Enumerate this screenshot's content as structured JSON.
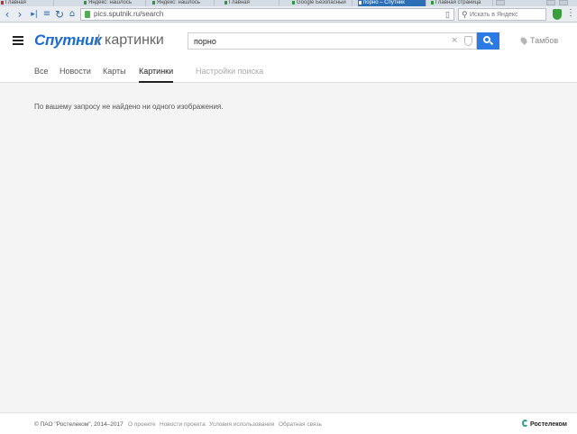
{
  "browser": {
    "tabs": [
      {
        "label": "Главная",
        "active": false
      },
      {
        "label": "Яндекс: нашлось",
        "active": false
      },
      {
        "label": "Яндекс: нашлось",
        "active": false
      },
      {
        "label": "Главная",
        "active": false
      },
      {
        "label": "Google Безопасный",
        "active": false
      },
      {
        "label": "порно – Спутник",
        "active": true
      },
      {
        "label": "Главная страница",
        "active": false
      }
    ],
    "url": "pics.sputnik.ru/search",
    "ya_search_placeholder": "Искать в Яндекс"
  },
  "header": {
    "logo": "Спутник",
    "separator": "/",
    "subtitle": "картинки",
    "search_value": "порно",
    "city": "Тамбов"
  },
  "tabs": [
    {
      "label": "Все",
      "active": false
    },
    {
      "label": "Новости",
      "active": false
    },
    {
      "label": "Карты",
      "active": false
    },
    {
      "label": "Картинки",
      "active": true
    },
    {
      "label": "Настройки поиска",
      "active": false
    }
  ],
  "main": {
    "message": "По вашему запросу не найдено ни одного изображения."
  },
  "footer": {
    "copyright": "© ПАО \"Ростелеком\", 2014–2017",
    "links": [
      "О проекте",
      "Новости проекта",
      "Условия использования",
      "Обратная связь"
    ],
    "brand": "Ростелеком"
  },
  "colors": {
    "accent": "#2c7be5",
    "logo": "#1a6bd2",
    "background": "#f4f4f4"
  }
}
